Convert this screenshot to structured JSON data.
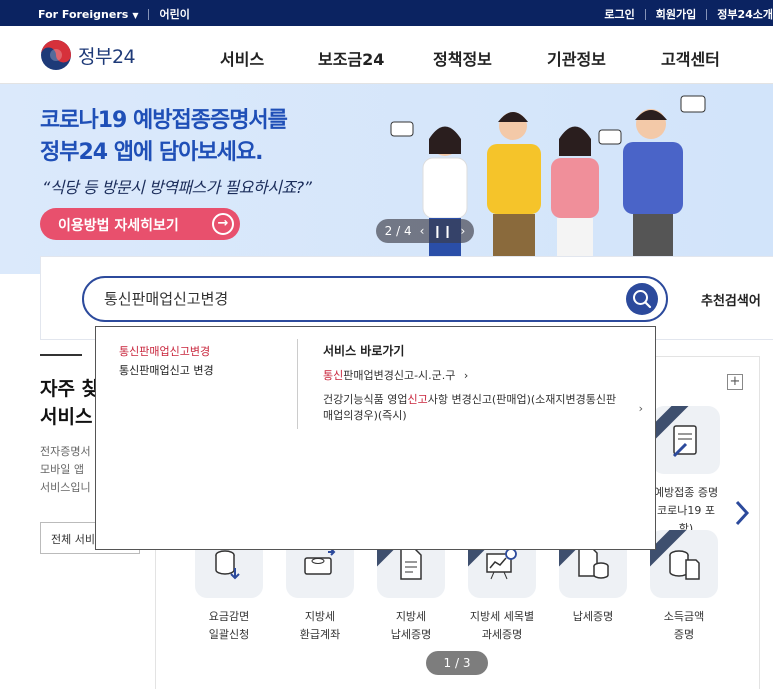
{
  "topbar": {
    "foreigners": "For Foreigners",
    "kids": "어린이",
    "login": "로그인",
    "signup": "회원가입",
    "intro": "정부24소개"
  },
  "header": {
    "logo_text": "정부24",
    "nav": [
      "서비스",
      "보조금24",
      "정책정보",
      "기관정보",
      "고객센터"
    ]
  },
  "banner": {
    "title_line1": "코로나19 예방접종증명서를",
    "title_line2": "정부24 앱에 담아보세요.",
    "subtitle": "“식당 등 방문시 방역패스가 필요하시죠?”",
    "button_label": "이용방법 자세히보기",
    "pager": "2 / 4"
  },
  "search": {
    "value": "통신판매업신고변경",
    "recommended_label": "추천검색어"
  },
  "autocomplete": {
    "suggestions": [
      {
        "highlight": "통신판매업신고변경",
        "rest": ""
      },
      {
        "highlight": "",
        "rest": "통신판매업신고 변경"
      }
    ],
    "shortcut_header": "서비스 바로가기",
    "shortcuts": [
      {
        "pre": "",
        "highlight": "통신",
        "post": "판매업변경신고-시.군.구"
      },
      {
        "pre": "건강기능식품 영업",
        "highlight": "신고",
        "post": "사항 변경신고(판매업)(소재지변경통신판매업의경우)(즉시)"
      }
    ]
  },
  "frequent": {
    "title_line1": "자주 찾",
    "title_line2": "서비스",
    "desc_lines": [
      "전자증명서",
      "모바일 앱",
      "서비스입니"
    ],
    "all_button": "전체 서비"
  },
  "services": {
    "top_right_label_line1": "예방접종 증명",
    "top_right_label_line2": "코로나19 포함)",
    "items": [
      {
        "line1": "요금감면",
        "line2": "일괄신청",
        "icon": "coins-icon"
      },
      {
        "line1": "지방세",
        "line2": "환급계좌",
        "icon": "refund-icon"
      },
      {
        "line1": "지방세",
        "line2": "납세증명",
        "icon": "document-icon"
      },
      {
        "line1": "지방세 세목별",
        "line2": "과세증명",
        "icon": "chart-search-icon"
      },
      {
        "line1": "납세증명",
        "line2": "",
        "icon": "tax-certificate-icon"
      },
      {
        "line1": "소득금액",
        "line2": "증명",
        "icon": "income-certificate-icon"
      }
    ],
    "pager": "1 / 3"
  },
  "colors": {
    "navy": "#0b2361",
    "accent_blue": "#2c4a9c",
    "banner_pink": "#e8506d",
    "highlight_red": "#c8253c"
  }
}
